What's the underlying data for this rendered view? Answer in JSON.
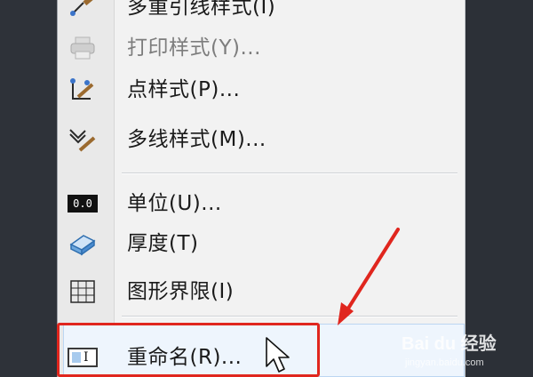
{
  "menu": {
    "items": [
      {
        "label": "多重引线样式(I)",
        "icon": "multileader-style-icon",
        "disabled": false
      },
      {
        "label": "打印样式(Y)...",
        "icon": "printer-icon",
        "disabled": true
      },
      {
        "label": "点样式(P)...",
        "icon": "point-style-icon",
        "disabled": false
      },
      {
        "label": "多线样式(M)...",
        "icon": "multiline-style-icon",
        "disabled": false
      },
      {
        "label": "单位(U)...",
        "icon": "units-icon",
        "disabled": false
      },
      {
        "label": "厚度(T)",
        "icon": "thickness-icon",
        "disabled": false
      },
      {
        "label": "图形界限(I)",
        "icon": "drawing-limits-icon",
        "disabled": false
      },
      {
        "label": "重命名(R)...",
        "icon": "rename-icon",
        "disabled": false
      }
    ],
    "units_icon_text": "0.0",
    "rename_icon_text": "I"
  },
  "colors": {
    "annotation_red": "#e0261e",
    "highlight": "#eef5fd",
    "background_dark": "#2b2f36"
  },
  "watermark": {
    "line1": "Bai du 经验",
    "line2": "jingyan.baidu.com"
  }
}
